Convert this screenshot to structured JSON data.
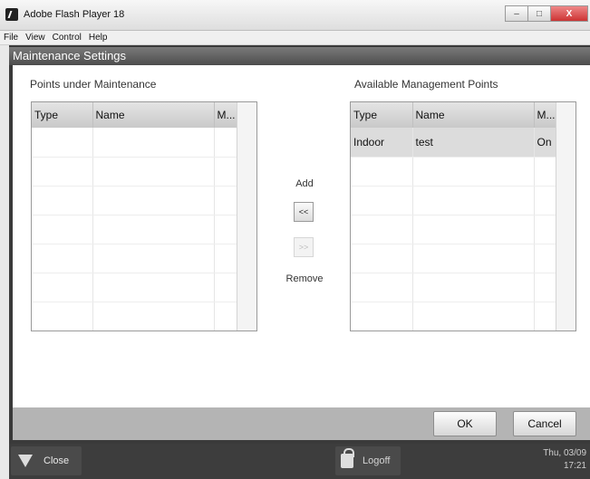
{
  "window": {
    "title": "Adobe Flash Player 18",
    "minimize": "–",
    "maximize": "□",
    "close": "X"
  },
  "menu": [
    "File",
    "View",
    "Control",
    "Help"
  ],
  "panel": {
    "title": "Maintenance Settings"
  },
  "left_table": {
    "label": "Points under Maintenance",
    "columns": [
      "Type",
      "Name",
      "M..."
    ],
    "rows": [
      [
        "",
        "",
        ""
      ],
      [
        "",
        "",
        ""
      ],
      [
        "",
        "",
        ""
      ],
      [
        "",
        "",
        ""
      ],
      [
        "",
        "",
        ""
      ],
      [
        "",
        "",
        ""
      ],
      [
        "",
        "",
        ""
      ]
    ]
  },
  "right_table": {
    "label": "Available Management Points",
    "columns": [
      "Type",
      "Name",
      "M..."
    ],
    "rows": [
      [
        "Indoor",
        "test",
        "On"
      ],
      [
        "",
        "",
        ""
      ],
      [
        "",
        "",
        ""
      ],
      [
        "",
        "",
        ""
      ],
      [
        "",
        "",
        ""
      ],
      [
        "",
        "",
        ""
      ],
      [
        "",
        "",
        ""
      ]
    ]
  },
  "transfer": {
    "add_label": "Add",
    "add_button": "<<",
    "remove_button": ">>",
    "remove_label": "Remove"
  },
  "dialog_buttons": {
    "ok": "OK",
    "cancel": "Cancel"
  },
  "bottom_bar": {
    "close": "Close",
    "logoff": "Logoff",
    "date": "Thu, 03/09",
    "time": "17:21"
  }
}
